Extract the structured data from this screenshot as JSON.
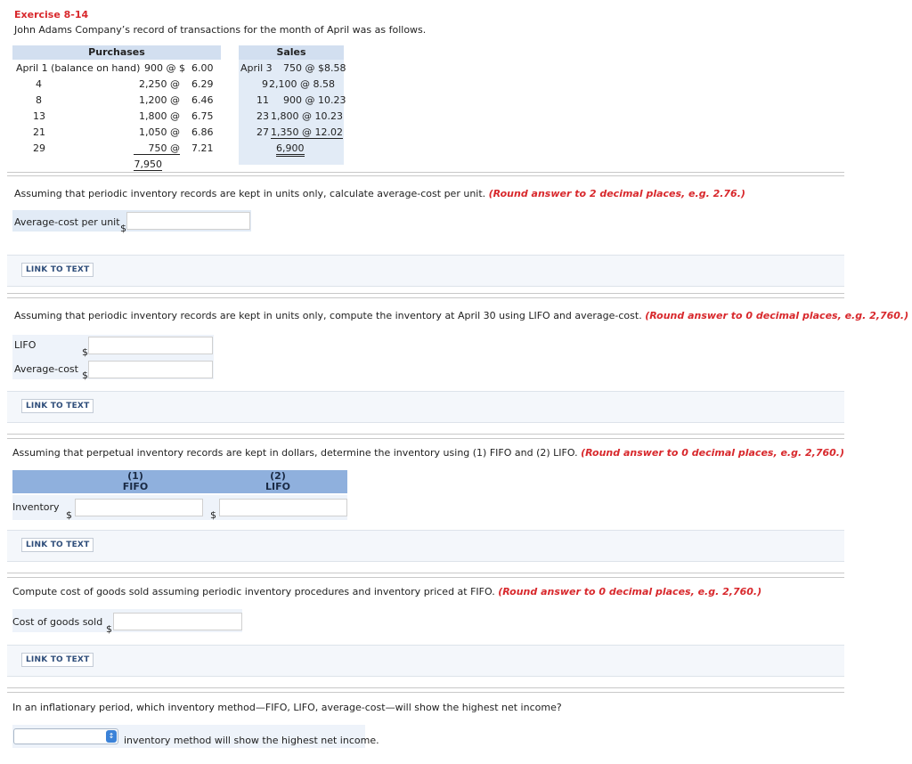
{
  "header": {
    "exercise_title": "Exercise 8-14",
    "intro": "John Adams Company’s record of transactions for the month of April was as follows."
  },
  "transactions": {
    "purchases_header": "Purchases",
    "sales_header": "Sales",
    "purchases": [
      {
        "date": "April 1 (balance on hand)",
        "units": "900 @ $",
        "price": "6.00"
      },
      {
        "date": "4",
        "units": "2,250 @",
        "price": "6.29"
      },
      {
        "date": "8",
        "units": "1,200 @",
        "price": "6.46"
      },
      {
        "date": "13",
        "units": "1,800 @",
        "price": "6.75"
      },
      {
        "date": "21",
        "units": "1,050 @",
        "price": "6.86"
      },
      {
        "date": "29",
        "units": "750 @",
        "price": "7.21"
      }
    ],
    "purchases_total": "7,950",
    "sales": [
      {
        "date": "April 3",
        "entry": "750 @ $8.58"
      },
      {
        "date": "9",
        "entry": "2,100 @  8.58"
      },
      {
        "date": "11",
        "entry": "900 @ 10.23"
      },
      {
        "date": "23",
        "entry": "1,800 @ 10.23"
      },
      {
        "date": "27",
        "entry": "1,350 @ 12.02"
      }
    ],
    "sales_total": "6,900"
  },
  "q1": {
    "prompt": "Assuming that periodic inventory records are kept in units only, calculate average-cost per unit.",
    "hint": "(Round answer to 2 decimal places, e.g. 2.76.)",
    "field_label": "Average-cost per unit",
    "currency": "$",
    "value": ""
  },
  "q2": {
    "prompt": "Assuming that periodic inventory records are kept in units only, compute the inventory at April 30 using LIFO and average-cost.",
    "hint": "(Round answer to 0 decimal places, e.g. 2,760.)",
    "lifo_label": "LIFO",
    "avg_label": "Average-cost",
    "currency": "$",
    "lifo_value": "",
    "avg_value": ""
  },
  "q3": {
    "prompt": "Assuming that perpetual inventory records are kept in dollars, determine the inventory using (1) FIFO and (2) LIFO.",
    "hint": "(Round answer to 0 decimal places, e.g. 2,760.)",
    "col1_num": "(1)",
    "col1_name": "FIFO",
    "col2_num": "(2)",
    "col2_name": "LIFO",
    "row_label": "Inventory",
    "currency": "$",
    "fifo_value": "",
    "lifo_value": ""
  },
  "q4": {
    "prompt": "Compute cost of goods sold assuming periodic inventory procedures and inventory priced at FIFO.",
    "hint": "(Round answer to 0 decimal places, e.g. 2,760.)",
    "field_label": "Cost of goods sold",
    "currency": "$",
    "value": ""
  },
  "q5": {
    "prompt": "In an inflationary period, which inventory method—FIFO, LIFO, average-cost—will show the highest net income?",
    "select_value": "",
    "suffix": "inventory method will show the highest net income."
  },
  "link_to_text": "LINK TO TEXT",
  "colors": {
    "accent_red": "#d8282c",
    "header_blue": "#8fb0dd",
    "cell_blue": "#e2ebf6"
  }
}
